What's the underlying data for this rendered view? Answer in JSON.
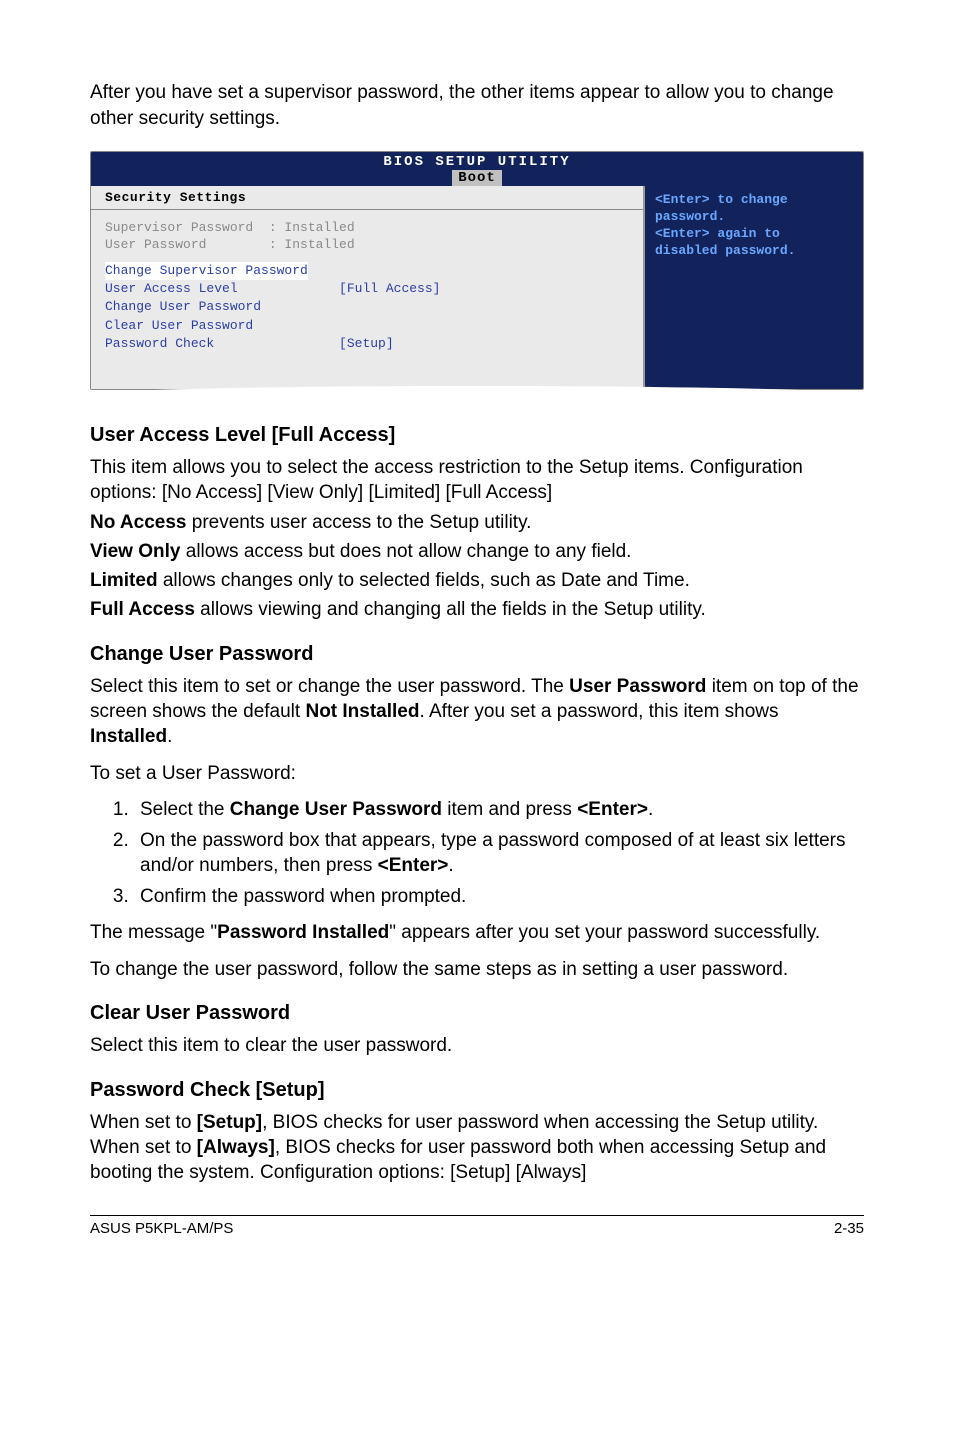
{
  "intro": "After you have set a supervisor password, the other items appear to allow you to change other security settings.",
  "bios": {
    "title": "BIOS SETUP UTILITY",
    "tab": "Boot",
    "sectionHeader": "Security Settings",
    "gray1": "Supervisor Password  : Installed",
    "gray2": "User Password        : Installed",
    "hl_row": "Change Supervisor Password",
    "row_ual_label": "User Access Level             ",
    "row_ual_value": "[Full Access]",
    "row_cup": "Change User Password",
    "row_clr": "Clear User Password",
    "row_pc_label": "Password Check                ",
    "row_pc_value": "[Setup]",
    "help1": "<Enter> to change",
    "help2": "password.",
    "help3": "<Enter> again to",
    "help4": "disabled password."
  },
  "sec1": {
    "title": "User Access Level [Full Access]",
    "p1": "This item allows you to select the access restriction to the Setup items. Configuration options: [No Access] [View Only] [Limited] [Full Access]",
    "na_b": "No Access",
    "na_t": " prevents user access to the Setup utility.",
    "vo_b": "View Only",
    "vo_t": " allows access but does not allow change to any field.",
    "lm_b": "Limited",
    "lm_t": " allows changes only to selected fields, such as Date and Time.",
    "fa_b": "Full Access",
    "fa_t": " allows viewing and changing all the fields in the Setup utility."
  },
  "sec2": {
    "title": "Change User Password",
    "p1a": "Select this item to set or change the user password. The ",
    "p1b": "User Password",
    "p1c": " item on top of the screen shows the default ",
    "p1d": "Not Installed",
    "p1e": ". After you set a password, this item shows ",
    "p1f": "Installed",
    "p1g": ".",
    "p2": "To set a User Password:",
    "li1a": "Select the ",
    "li1b": "Change User Password",
    "li1c": " item and press ",
    "li1d": "<Enter>",
    "li1e": ".",
    "li2a": "On the password box that appears, type a password composed of at least six letters and/or numbers, then press ",
    "li2b": "<Enter>",
    "li2c": ".",
    "li3": "Confirm the password when prompted.",
    "p3a": "The message \"",
    "p3b": "Password Installed",
    "p3c": "\" appears after you set your password successfully.",
    "p4": "To change the user password, follow the same steps as in setting a user password."
  },
  "sec3": {
    "title": "Clear User Password",
    "p1": "Select this item to clear the user password."
  },
  "sec4": {
    "title": "Password Check [Setup]",
    "p1a": "When set to ",
    "p1b": "[Setup]",
    "p1c": ", BIOS checks for user password when accessing the Setup utility. When set to ",
    "p1d": "[Always]",
    "p1e": ", BIOS checks for user password both when accessing Setup and booting the system. Configuration options: [Setup] [Always]"
  },
  "footer": {
    "left": "ASUS P5KPL-AM/PS",
    "right": "2-35"
  }
}
